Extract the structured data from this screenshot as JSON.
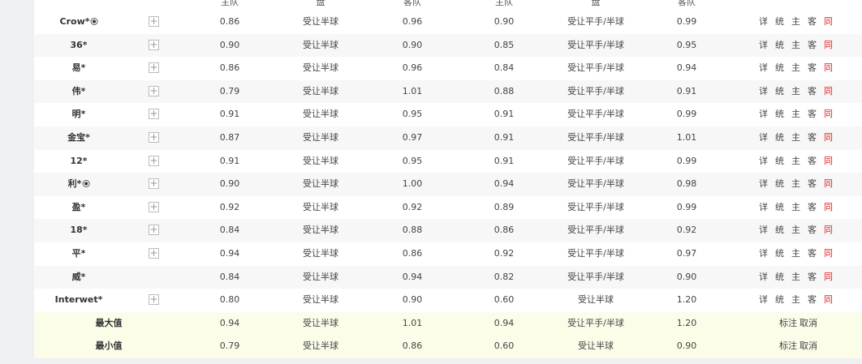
{
  "header": {
    "home": "主队",
    "handicap": "盘",
    "away": "客队",
    "home2": "主队",
    "handicap2": "盘",
    "away2": "客队"
  },
  "actions": {
    "detail": "详",
    "stats": "统",
    "home": "主",
    "away": "客",
    "same": "同"
  },
  "summary_actions": {
    "mark": "标注",
    "cancel": "取消"
  },
  "companies": [
    {
      "name": "Crow*",
      "ball": true,
      "plus": true,
      "h1": "0.86",
      "p1": "受让半球",
      "a1": "0.96",
      "h2": "0.90",
      "p2": "受让平手/半球",
      "a2": "0.99"
    },
    {
      "name": "36*",
      "ball": false,
      "plus": true,
      "h1": "0.90",
      "p1": "受让半球",
      "a1": "0.90",
      "h2": "0.85",
      "p2": "受让平手/半球",
      "a2": "0.95"
    },
    {
      "name": "易*",
      "ball": false,
      "plus": true,
      "h1": "0.86",
      "p1": "受让半球",
      "a1": "0.96",
      "h2": "0.84",
      "p2": "受让平手/半球",
      "a2": "0.94"
    },
    {
      "name": "伟*",
      "ball": false,
      "plus": true,
      "h1": "0.79",
      "p1": "受让半球",
      "a1": "1.01",
      "h2": "0.88",
      "p2": "受让平手/半球",
      "a2": "0.91"
    },
    {
      "name": "明*",
      "ball": false,
      "plus": true,
      "h1": "0.91",
      "p1": "受让半球",
      "a1": "0.95",
      "h2": "0.91",
      "p2": "受让平手/半球",
      "a2": "0.99"
    },
    {
      "name": "金宝*",
      "ball": false,
      "plus": true,
      "h1": "0.87",
      "p1": "受让半球",
      "a1": "0.97",
      "h2": "0.91",
      "p2": "受让平手/半球",
      "a2": "1.01"
    },
    {
      "name": "12*",
      "ball": false,
      "plus": true,
      "h1": "0.91",
      "p1": "受让半球",
      "a1": "0.95",
      "h2": "0.91",
      "p2": "受让平手/半球",
      "a2": "0.99"
    },
    {
      "name": "利*",
      "ball": true,
      "plus": true,
      "h1": "0.90",
      "p1": "受让半球",
      "a1": "1.00",
      "h2": "0.94",
      "p2": "受让平手/半球",
      "a2": "0.98"
    },
    {
      "name": "盈*",
      "ball": false,
      "plus": true,
      "h1": "0.92",
      "p1": "受让半球",
      "a1": "0.92",
      "h2": "0.89",
      "p2": "受让平手/半球",
      "a2": "0.99"
    },
    {
      "name": "18*",
      "ball": false,
      "plus": true,
      "h1": "0.84",
      "p1": "受让半球",
      "a1": "0.88",
      "h2": "0.86",
      "p2": "受让平手/半球",
      "a2": "0.92"
    },
    {
      "name": "平*",
      "ball": false,
      "plus": true,
      "h1": "0.94",
      "p1": "受让半球",
      "a1": "0.86",
      "h2": "0.92",
      "p2": "受让平手/半球",
      "a2": "0.97"
    },
    {
      "name": "威*",
      "ball": false,
      "plus": false,
      "h1": "0.84",
      "p1": "受让半球",
      "a1": "0.94",
      "h2": "0.82",
      "p2": "受让平手/半球",
      "a2": "0.90"
    },
    {
      "name": "Interwet*",
      "ball": false,
      "plus": true,
      "h1": "0.80",
      "p1": "受让半球",
      "a1": "0.90",
      "h2": "0.60",
      "p2": "受让半球",
      "a2": "1.20"
    }
  ],
  "summary": [
    {
      "label": "最大值",
      "h1": "0.94",
      "p1": "受让半球",
      "a1": "1.01",
      "h2": "0.94",
      "p2": "受让平手/半球",
      "a2": "1.20"
    },
    {
      "label": "最小值",
      "h1": "0.79",
      "p1": "受让半球",
      "a1": "0.86",
      "h2": "0.60",
      "p2": "受让半球",
      "a2": "0.90"
    }
  ]
}
